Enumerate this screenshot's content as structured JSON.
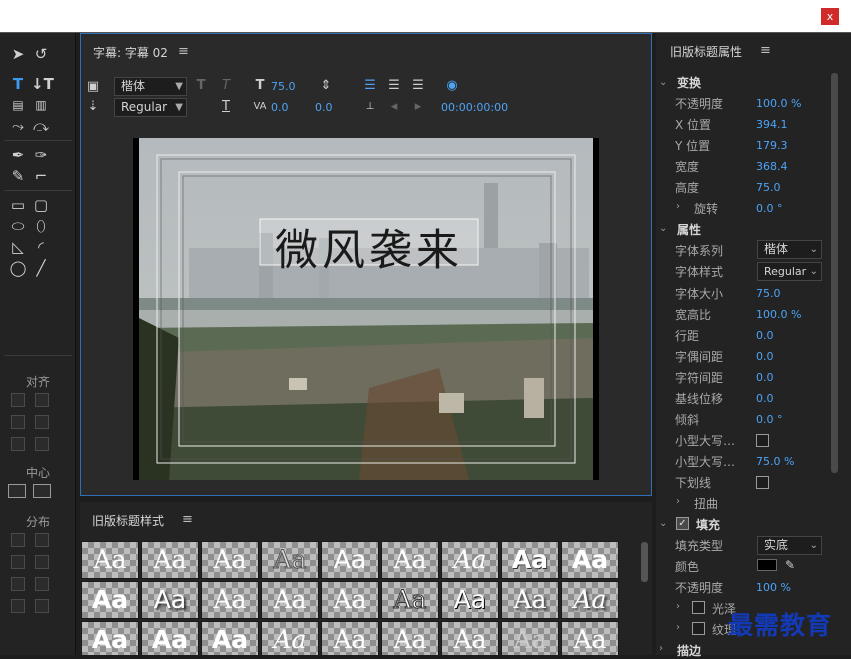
{
  "window": {
    "close_label": "x"
  },
  "tools": {
    "align_label": "对齐",
    "center_label": "中心",
    "distribute_label": "分布"
  },
  "title_panel": {
    "title": "字幕: 字幕 02",
    "menu": "≡",
    "font_family": "楷体",
    "font_style": "Regular",
    "font_size": "75.0",
    "tracking": "0.0",
    "leading": "0.0",
    "timecode": "00:00:00:00"
  },
  "canvas": {
    "title_text": "微风袭来"
  },
  "styles_panel": {
    "title": "旧版标题样式",
    "menu": "≡",
    "swatch_label": "Aa",
    "swatches": [
      "Aa",
      "Aa",
      "Aa",
      "Aa",
      "Aa",
      "Aa",
      "Aa",
      "Aa",
      "Aa",
      "Aa",
      "Aa",
      "Aa",
      "Aa",
      "Aa",
      "Aa",
      "Aa",
      "Aa",
      "Aa",
      "Aa",
      "Aa",
      "Aa",
      "Aa",
      "Aa",
      "Aa",
      "Aa",
      "Aa",
      "Aa"
    ]
  },
  "properties_panel": {
    "title": "旧版标题属性",
    "menu": "≡",
    "transform": {
      "header": "变换",
      "opacity_label": "不透明度",
      "opacity": "100.0 %",
      "x_label": "X 位置",
      "x": "394.1",
      "y_label": "Y 位置",
      "y": "179.3",
      "width_label": "宽度",
      "width": "368.4",
      "height_label": "高度",
      "height": "75.0",
      "rotation_label": "旋转",
      "rotation": "0.0 °"
    },
    "attributes": {
      "header": "属性",
      "font_family_label": "字体系列",
      "font_family": "楷体",
      "font_style_label": "字体样式",
      "font_style": "Regular",
      "font_size_label": "字体大小",
      "font_size": "75.0",
      "aspect_label": "宽高比",
      "aspect": "100.0 %",
      "leading_label": "行距",
      "leading": "0.0",
      "kerning_label": "字偶间距",
      "kerning": "0.0",
      "tracking_label": "字符间距",
      "tracking": "0.0",
      "baseline_label": "基线位移",
      "baseline": "0.0",
      "slant_label": "倾斜",
      "slant": "0.0 °",
      "small_caps_label": "小型大写…",
      "small_caps_size_label": "小型大写…",
      "small_caps_size": "75.0 %",
      "underline_label": "下划线",
      "distort_label": "扭曲"
    },
    "fill": {
      "header": "填充",
      "fill_type_label": "填充类型",
      "fill_type": "实底",
      "color_label": "颜色",
      "color": "#000000",
      "opacity_label": "不透明度",
      "opacity": "100 %",
      "sheen_label": "光泽",
      "texture_label": "纹理"
    },
    "next_header": "描边"
  },
  "watermark": "最需教育",
  "colors": {
    "accent": "#4da3f5",
    "panel_border": "#2e6fb8",
    "close": "#d12a2a"
  }
}
